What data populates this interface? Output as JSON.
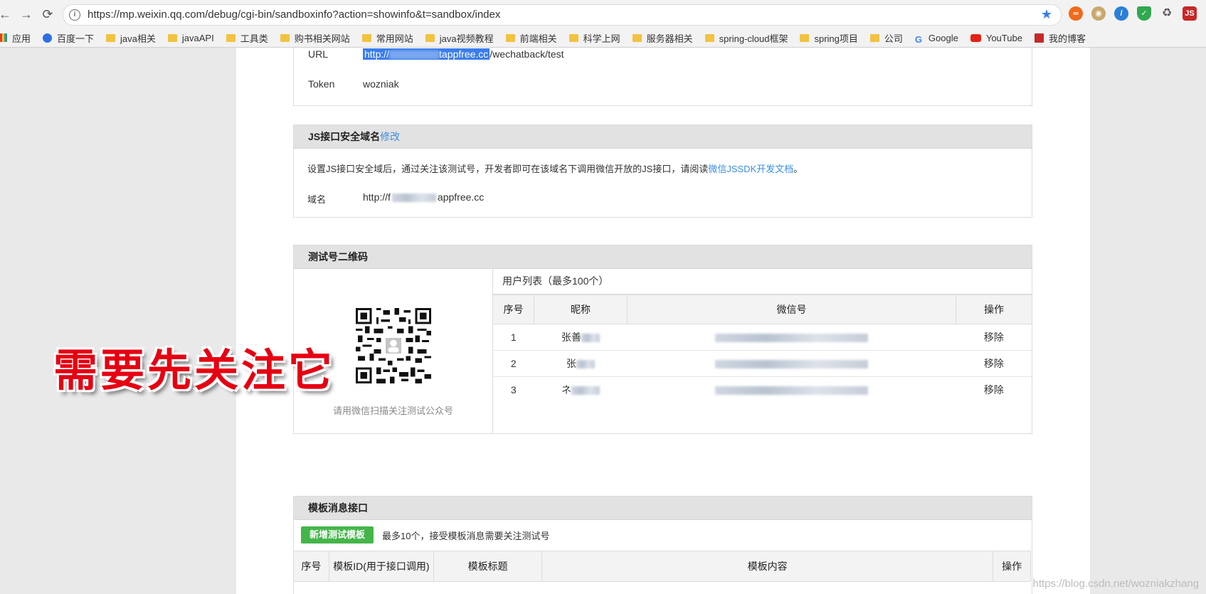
{
  "browser": {
    "url": "https://mp.weixin.qq.com/debug/cgi-bin/sandboxinfo?action=showinfo&t=sandbox/index",
    "bookmarks": [
      "应用",
      "百度一下",
      "java相关",
      "javaAPI",
      "工具类",
      "购书相关网站",
      "常用网站",
      "java视频教程",
      "前端相关",
      "科学上网",
      "服务器相关",
      "spring-cloud框架",
      "spring项目",
      "公司",
      "Google",
      "YouTube",
      "我的博客"
    ]
  },
  "config": {
    "url_label": "URL",
    "url_value_prefix": "http://",
    "url_value_mid": "tappfree.cc",
    "url_value_suffix": "/wechatback/test",
    "token_label": "Token",
    "token_value": "wozniak"
  },
  "js_domain": {
    "title": "JS接口安全域名",
    "edit_link": "修改",
    "desc_prefix": "设置JS接口安全域后，通过关注该测试号，开发者即可在该域名下调用微信开放的JS接口，请阅读",
    "desc_link": "微信JSSDK开发文档",
    "desc_suffix": "。",
    "domain_label": "域名",
    "domain_prefix": "http://f",
    "domain_suffix": "appfree.cc"
  },
  "qr_section": {
    "title": "测试号二维码",
    "caption": "请用微信扫描关注测试公众号",
    "user_list_title": "用户列表（最多100个）",
    "columns": [
      "序号",
      "昵称",
      "微信号",
      "操作"
    ],
    "rows": [
      {
        "index": "1",
        "nickname": "张善",
        "action": "移除"
      },
      {
        "index": "2",
        "nickname": "张",
        "action": "移除"
      },
      {
        "index": "3",
        "nickname": "ネ",
        "action": "移除"
      }
    ]
  },
  "template_section": {
    "title": "模板消息接口",
    "add_button": "新增测试模板",
    "note": "最多10个，接受模板消息需要关注测试号",
    "columns": [
      "序号",
      "模板ID(用于接口调用)",
      "模板标题",
      "模板内容",
      "操作"
    ]
  },
  "overlay": "需要先关注它",
  "watermark": "https://blog.csdn.net/wozniakzhang"
}
